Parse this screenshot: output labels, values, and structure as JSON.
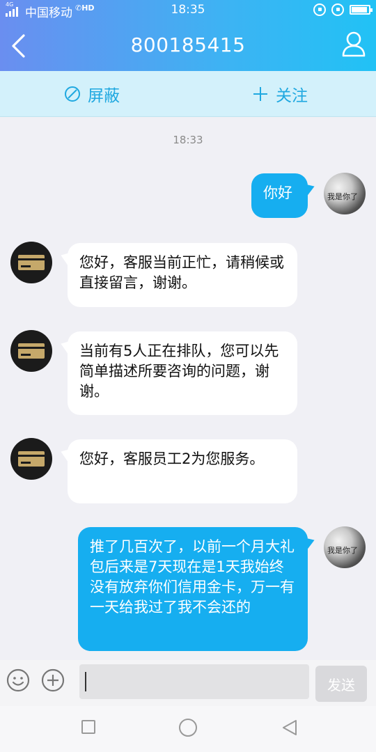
{
  "status_bar": {
    "network": "4G",
    "carrier": "中国移动",
    "hd": "HD",
    "time": "18:35"
  },
  "header": {
    "title": "800185415",
    "back_icon": "chevron-left-icon",
    "profile_icon": "person-icon"
  },
  "actions": {
    "block_label": "屏蔽",
    "follow_label": "关注"
  },
  "chat": {
    "timestamp": "18:33",
    "messages": [
      {
        "from": "me",
        "text": "你好"
      },
      {
        "from": "service",
        "text": "您好，客服当前正忙，请稍候或直接留言，谢谢。"
      },
      {
        "from": "service",
        "text": "当前有5人正在排队，您可以先简单描述所要咨询的问题，谢谢。"
      },
      {
        "from": "service",
        "text": "您好，客服员工2为您服务。"
      },
      {
        "from": "me",
        "text": "推了几百次了，以前一个月大礼包后来是7天现在是1天我始终没有放弃你们信用金卡，万一有一天给我过了我不会还的"
      }
    ],
    "user_avatar_text": "我是你了"
  },
  "input_bar": {
    "value": "",
    "send_label": "发送"
  },
  "colors": {
    "accent": "#16aef0",
    "header_start": "#6a8ef0",
    "header_end": "#21c2f5",
    "action_bar_bg": "#d3f1fb",
    "chat_bg": "#f0f0f5"
  }
}
